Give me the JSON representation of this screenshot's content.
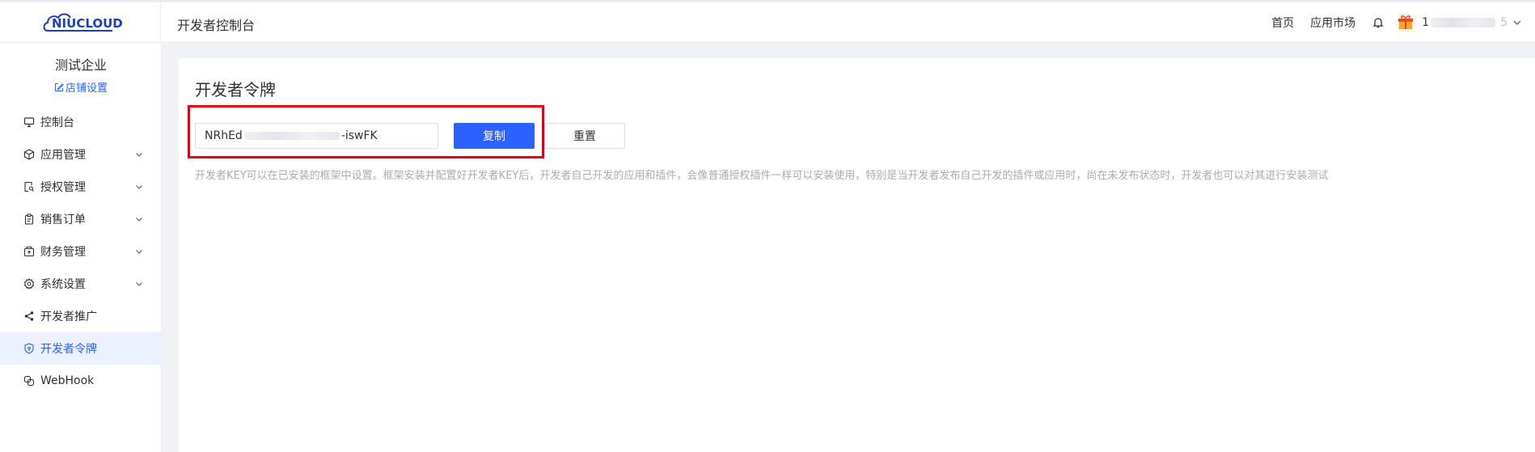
{
  "header": {
    "logo_text": "NIUCLOUD",
    "title": "开发者控制台",
    "links": [
      "首页",
      "应用市场"
    ],
    "username_prefix": "1",
    "username_suffix": "5"
  },
  "sidebar": {
    "company": "测试企业",
    "shop_settings": "店铺设置",
    "items": [
      {
        "label": "控制台",
        "icon": "monitor-icon",
        "expandable": false
      },
      {
        "label": "应用管理",
        "icon": "cube-icon",
        "expandable": true
      },
      {
        "label": "授权管理",
        "icon": "key-document-icon",
        "expandable": true
      },
      {
        "label": "销售订单",
        "icon": "clipboard-icon",
        "expandable": true
      },
      {
        "label": "财务管理",
        "icon": "wallet-icon",
        "expandable": true
      },
      {
        "label": "系统设置",
        "icon": "gear-icon",
        "expandable": true
      },
      {
        "label": "开发者推广",
        "icon": "share-icon",
        "expandable": false
      },
      {
        "label": "开发者令牌",
        "icon": "shield-icon",
        "expandable": false,
        "active": true
      },
      {
        "label": "WebHook",
        "icon": "webhook-icon",
        "expandable": false
      }
    ]
  },
  "main": {
    "title": "开发者令牌",
    "token_prefix": "NRhEd",
    "token_suffix": "-iswFK",
    "copy_label": "复制",
    "reset_label": "重置",
    "description": "开发者KEY可以在已安装的框架中设置。框架安装并配置好开发者KEY后，开发者自己开发的应用和插件，会像普通授权插件一样可以安装使用，特别是当开发者发布自己开发的插件或应用时，尚在未发布状态时，开发者也可以对其进行安装测试"
  },
  "colors": {
    "primary": "#2a61ff",
    "highlight_box": "#e60012",
    "active_bg": "#ecf1ff"
  }
}
